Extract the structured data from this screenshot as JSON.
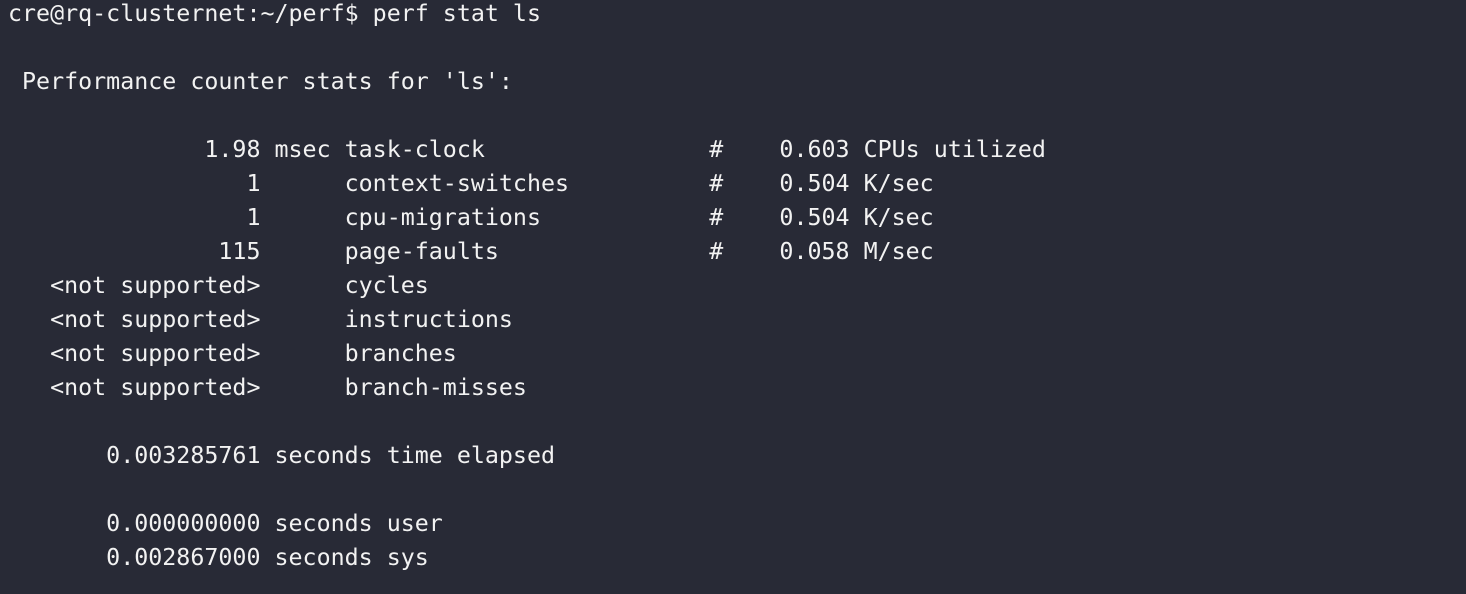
{
  "terminal": {
    "lines": [
      "cre@rq-clusternet:~/perf$ perf stat ls",
      "",
      " Performance counter stats for 'ls':",
      "",
      "              1.98 msec task-clock                #    0.603 CPUs utilized",
      "                 1      context-switches          #    0.504 K/sec",
      "                 1      cpu-migrations            #    0.504 K/sec",
      "               115      page-faults               #    0.058 M/sec",
      "   <not supported>      cycles",
      "   <not supported>      instructions",
      "   <not supported>      branches",
      "   <not supported>      branch-misses",
      "",
      "       0.003285761 seconds time elapsed",
      "",
      "       0.000000000 seconds user",
      "       0.002867000 seconds sys"
    ]
  },
  "colors": {
    "background": "#282a36",
    "foreground": "#f2f2f2"
  }
}
